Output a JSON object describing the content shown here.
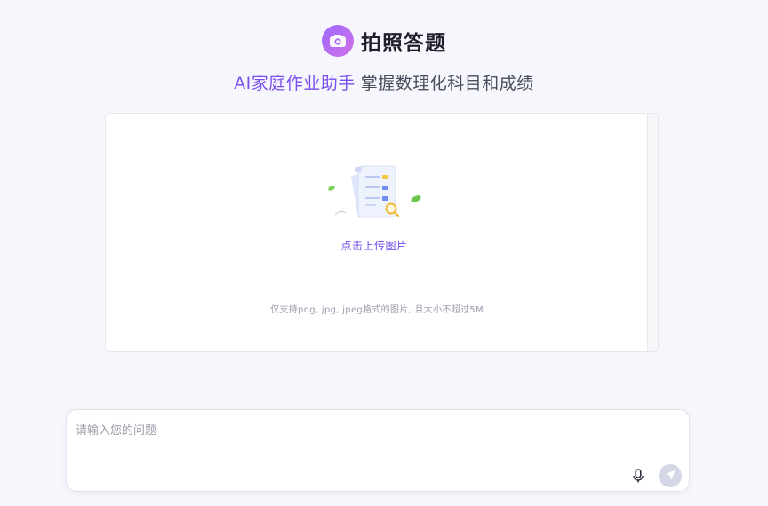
{
  "header": {
    "title": "拍照答题",
    "subtitle_accent": "AI家庭作业助手",
    "subtitle_rest": "掌握数理化科目和成绩"
  },
  "upload": {
    "label": "点击上传图片",
    "hint": "仅支持png, jpg, jpeg格式的图片, 且大小不超过5M"
  },
  "question": {
    "placeholder": "请输入您的问题",
    "value": ""
  },
  "icons": {
    "logo": "camera-icon",
    "upload": "document-magnifier-illustration",
    "mic": "microphone-icon",
    "send": "send-icon"
  },
  "colors": {
    "accent": "#7a4ff0",
    "send_disabled": "#d5d7e6",
    "background": "#f6f7fc"
  }
}
